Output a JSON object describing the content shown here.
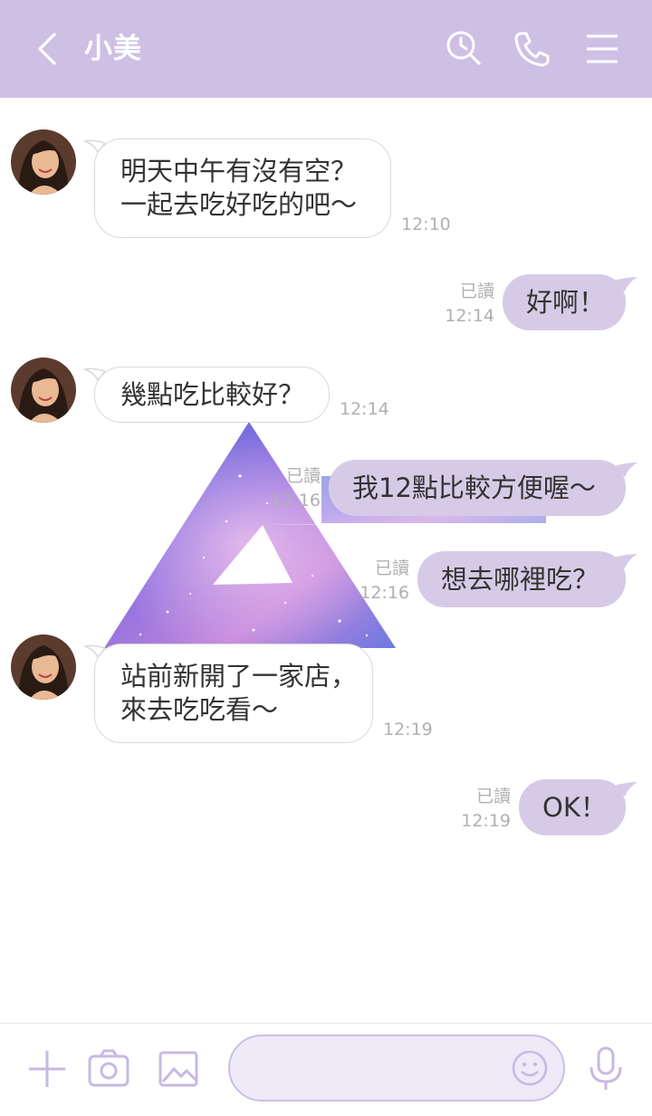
{
  "header": {
    "title": "小美",
    "back_icon": "chevron-left-icon",
    "icons": [
      "search-clock-icon",
      "phone-icon",
      "menu-icon"
    ],
    "background": "#cdc0e4"
  },
  "messages": [
    {
      "from": "them",
      "lines": [
        "明天中午有沒有空？",
        "一起去吃好吃的吧～"
      ],
      "time": "12:10"
    },
    {
      "from": "me",
      "text": "好啊！",
      "read": "已讀",
      "time": "12:14"
    },
    {
      "from": "them",
      "lines": [
        "幾點吃比較好？"
      ],
      "time": "12:14"
    },
    {
      "from": "me",
      "text": "我12點比較方便喔～",
      "read": "已讀",
      "time": "12:16"
    },
    {
      "from": "me",
      "text": "想去哪裡吃？",
      "read": "已讀",
      "time": "12:16"
    },
    {
      "from": "them",
      "lines": [
        "站前新開了一家店，",
        "來去吃吃看～"
      ],
      "time": "12:19"
    },
    {
      "from": "me",
      "text": "OK！",
      "read": "已讀",
      "time": "12:19"
    }
  ],
  "footer": {
    "icons": [
      "plus-icon",
      "camera-icon",
      "image-icon",
      "smiley-icon",
      "microphone-icon"
    ],
    "input_value": ""
  },
  "colors": {
    "outgoing_bubble": "#d6cbe7",
    "incoming_bubble": "#ffffff",
    "accent": "#cbbfe4"
  }
}
